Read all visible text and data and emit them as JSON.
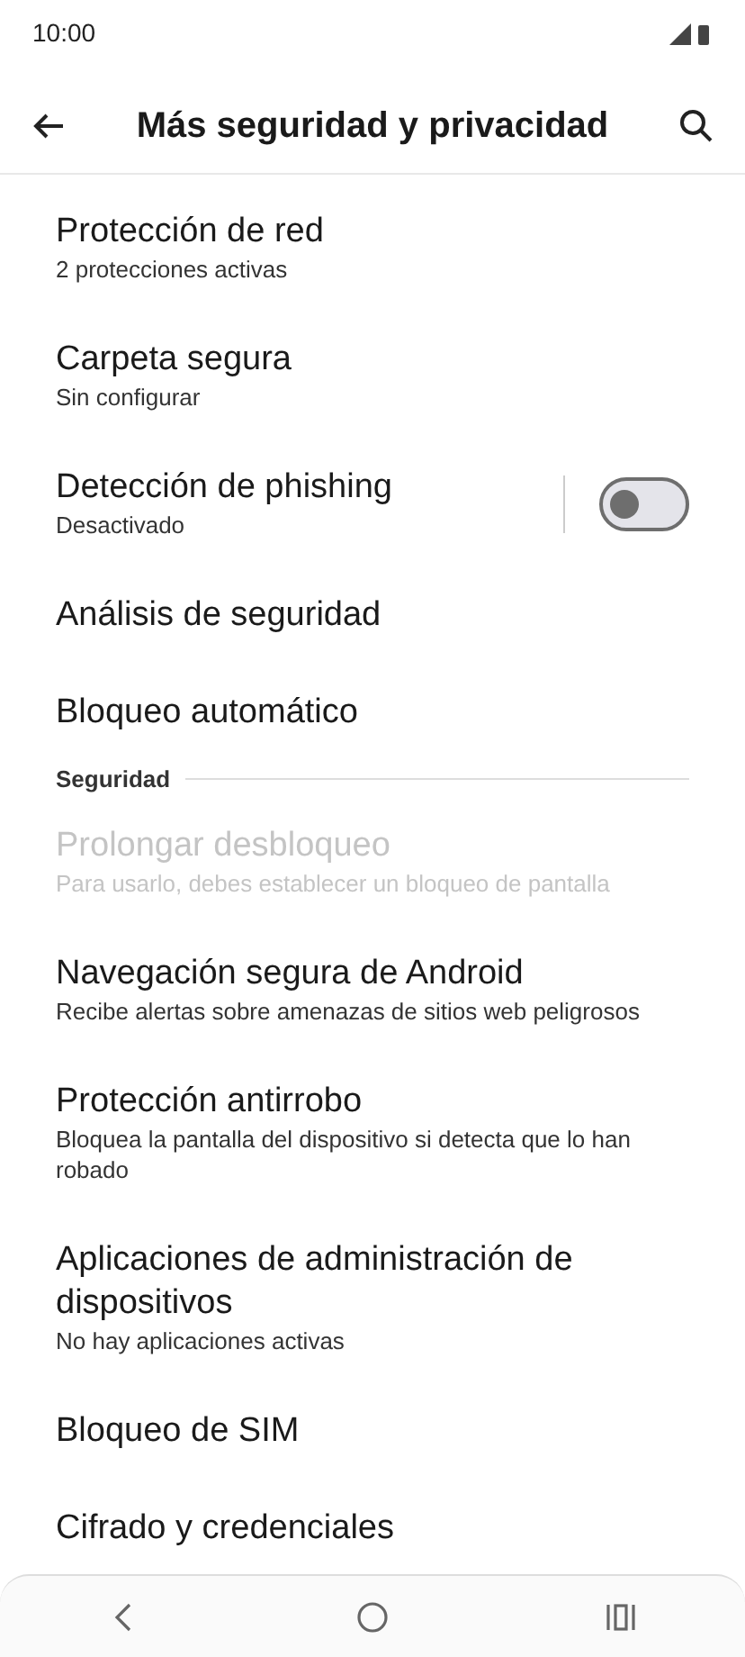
{
  "status_bar": {
    "time": "10:00"
  },
  "header": {
    "title": "Más seguridad y privacidad"
  },
  "items": [
    {
      "kind": "setting",
      "title": "Protección de red",
      "subtitle": "2 protecciones activas",
      "disabled": false
    },
    {
      "kind": "setting",
      "title": "Carpeta segura",
      "subtitle": "Sin configurar",
      "disabled": false
    },
    {
      "kind": "toggle",
      "title": "Detección de phishing",
      "subtitle": "Desactivado",
      "disabled": false,
      "on": false
    },
    {
      "kind": "setting",
      "title": "Análisis de seguridad",
      "disabled": false
    },
    {
      "kind": "setting",
      "title": "Bloqueo automático",
      "disabled": false
    },
    {
      "kind": "section",
      "title": "Seguridad"
    },
    {
      "kind": "setting",
      "title": "Prolongar desbloqueo",
      "subtitle": "Para usarlo, debes establecer un bloqueo de pantalla",
      "disabled": true
    },
    {
      "kind": "setting",
      "title": "Navegación segura de Android",
      "subtitle": "Recibe alertas sobre amenazas de sitios web peligrosos",
      "disabled": false
    },
    {
      "kind": "setting",
      "title": "Protección antirrobo",
      "subtitle": "Bloquea la pantalla del dispositivo si detecta que lo han robado",
      "disabled": false
    },
    {
      "kind": "setting",
      "title": "Aplicaciones de administración de dispositivos",
      "subtitle": "No hay aplicaciones activas",
      "disabled": false
    },
    {
      "kind": "setting",
      "title": "Bloqueo de SIM",
      "disabled": false
    },
    {
      "kind": "setting",
      "title": "Cifrado y credenciales",
      "disabled": false
    }
  ]
}
